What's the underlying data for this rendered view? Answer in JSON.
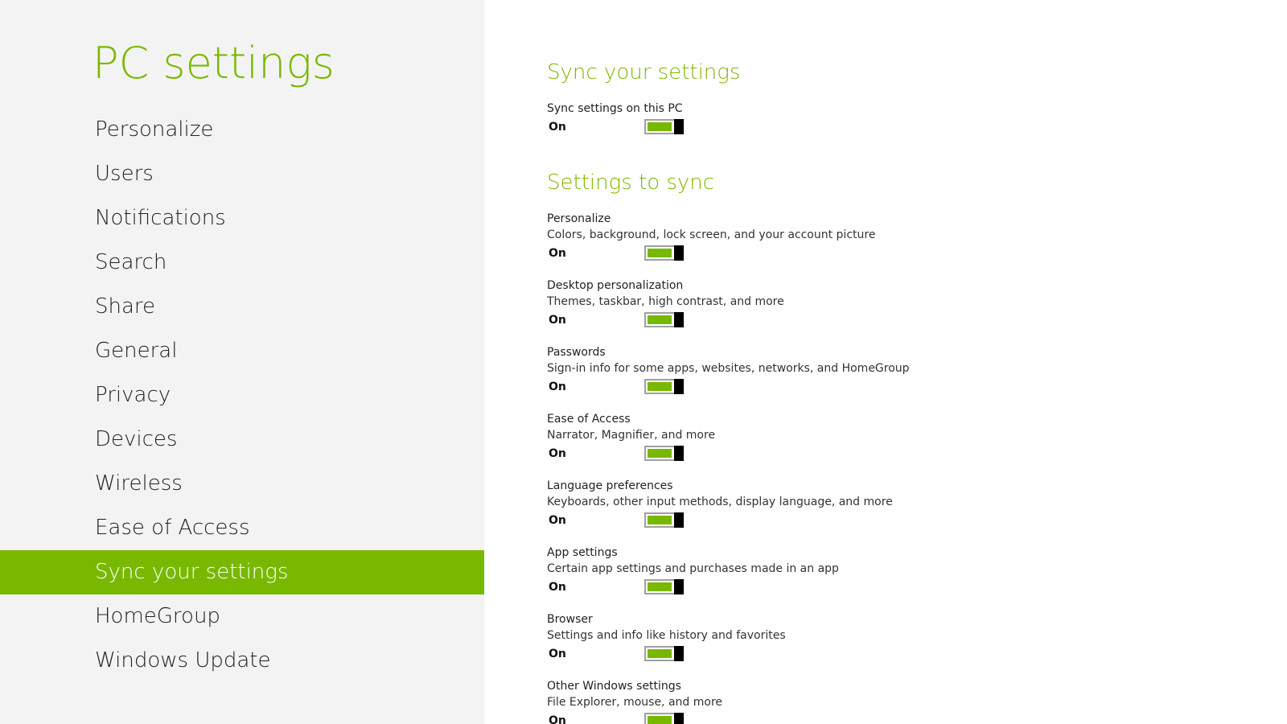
{
  "nav": {
    "title": "PC settings",
    "items": [
      {
        "label": "Personalize",
        "selected": false
      },
      {
        "label": "Users",
        "selected": false
      },
      {
        "label": "Notifications",
        "selected": false
      },
      {
        "label": "Search",
        "selected": false
      },
      {
        "label": "Share",
        "selected": false
      },
      {
        "label": "General",
        "selected": false
      },
      {
        "label": "Privacy",
        "selected": false
      },
      {
        "label": "Devices",
        "selected": false
      },
      {
        "label": "Wireless",
        "selected": false
      },
      {
        "label": "Ease of Access",
        "selected": false
      },
      {
        "label": "Sync your settings",
        "selected": true
      },
      {
        "label": "HomeGroup",
        "selected": false
      },
      {
        "label": "Windows Update",
        "selected": false
      }
    ]
  },
  "content": {
    "sync_heading": "Sync your settings",
    "sync_pc": {
      "title": "Sync settings on this PC",
      "state": "On"
    },
    "settings_heading": "Settings to sync",
    "settings": [
      {
        "title": "Personalize",
        "desc": "Colors, background, lock screen, and your account picture",
        "state": "On"
      },
      {
        "title": "Desktop personalization",
        "desc": "Themes, taskbar, high contrast, and more",
        "state": "On"
      },
      {
        "title": "Passwords",
        "desc": "Sign-in info for some apps, websites, networks, and HomeGroup",
        "state": "On"
      },
      {
        "title": "Ease of Access",
        "desc": "Narrator, Magnifier, and more",
        "state": "On"
      },
      {
        "title": "Language preferences",
        "desc": "Keyboards, other input methods, display language, and more",
        "state": "On"
      },
      {
        "title": "App settings",
        "desc": "Certain app settings and purchases made in an app",
        "state": "On"
      },
      {
        "title": "Browser",
        "desc": "Settings and info like history and favorites",
        "state": "On"
      },
      {
        "title": "Other Windows settings",
        "desc": "File Explorer, mouse, and more",
        "state": "On"
      }
    ]
  },
  "colors": {
    "accent": "#78b800",
    "nav_background": "#f3f3f3",
    "toggle_thumb": "#000000"
  }
}
